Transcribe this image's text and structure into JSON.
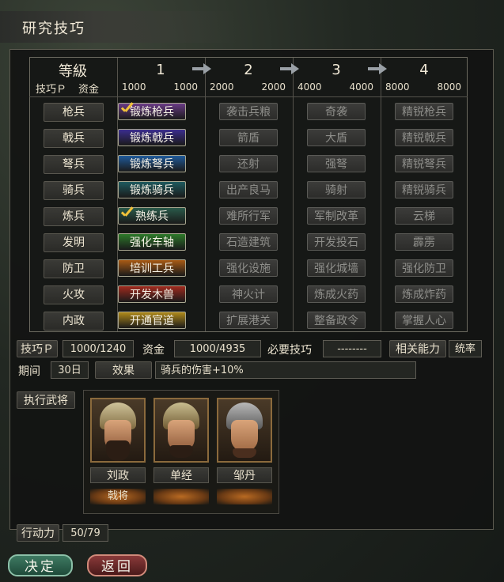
{
  "window": {
    "title": "研究技巧"
  },
  "header": {
    "level_label": "等級",
    "tech_p_label": "技巧Ｐ",
    "funds_label": "资金",
    "tiers": [
      {
        "num": "1",
        "p": "1000",
        "f": "1000"
      },
      {
        "num": "2",
        "p": "2000",
        "f": "2000"
      },
      {
        "num": "3",
        "p": "4000",
        "f": "4000"
      },
      {
        "num": "4",
        "p": "8000",
        "f": "8000"
      }
    ]
  },
  "rows": [
    {
      "label": "枪兵",
      "cells": [
        "锻炼枪兵",
        "袭击兵粮",
        "奇袭",
        "精锐枪兵"
      ],
      "colors": [
        "#6a3b86",
        "",
        "",
        ""
      ],
      "checked": true
    },
    {
      "label": "戟兵",
      "cells": [
        "锻炼戟兵",
        "箭盾",
        "大盾",
        "精锐戟兵"
      ],
      "colors": [
        "#3b2e8e",
        "",
        "",
        ""
      ],
      "checked": false
    },
    {
      "label": "弩兵",
      "cells": [
        "锻炼弩兵",
        "还射",
        "强弩",
        "精锐弩兵"
      ],
      "colors": [
        "#1f5a9a",
        "",
        "",
        ""
      ],
      "checked": false
    },
    {
      "label": "骑兵",
      "cells": [
        "锻炼骑兵",
        "出产良马",
        "骑射",
        "精锐骑兵"
      ],
      "colors": [
        "#1e5a5e",
        "",
        "",
        ""
      ],
      "checked": false
    },
    {
      "label": "炼兵",
      "cells": [
        "熟练兵",
        "难所行军",
        "军制改革",
        "云梯"
      ],
      "colors": [
        "#2a5a4a",
        "",
        "",
        ""
      ],
      "checked": true
    },
    {
      "label": "发明",
      "cells": [
        "强化车轴",
        "石造建筑",
        "开发投石",
        "霹雳"
      ],
      "colors": [
        "#2e7a2a",
        "",
        "",
        ""
      ],
      "checked": false
    },
    {
      "label": "防卫",
      "cells": [
        "培训工兵",
        "强化设施",
        "强化城墙",
        "强化防卫"
      ],
      "colors": [
        "#a85a14",
        "",
        "",
        ""
      ],
      "checked": false
    },
    {
      "label": "火攻",
      "cells": [
        "开发木兽",
        "神火计",
        "炼成火药",
        "炼成炸药"
      ],
      "colors": [
        "#a02a1e",
        "",
        "",
        ""
      ],
      "checked": false
    },
    {
      "label": "内政",
      "cells": [
        "开通官道",
        "扩展港关",
        "整备政令",
        "掌握人心"
      ],
      "colors": [
        "#b08a1a",
        "",
        "",
        ""
      ],
      "checked": false
    }
  ],
  "info": {
    "tech_p_label": "技巧Ｐ",
    "tech_p_value": "1000/1240",
    "funds_label": "资金",
    "funds_value": "1000/4935",
    "req_label": "必要技巧",
    "req_value": "--------",
    "ability_label": "相关能力",
    "ability_value": "统率",
    "period_label": "期间",
    "period_value": "30日",
    "effect_label": "效果",
    "effect_value": "骑兵的伤害+10%"
  },
  "officers": {
    "section_label": "执行武将",
    "list": [
      {
        "name": "刘政",
        "trait": "戟将"
      },
      {
        "name": "单经",
        "trait": ""
      },
      {
        "name": "邹丹",
        "trait": ""
      }
    ]
  },
  "action": {
    "label": "行动力",
    "value": "50/79"
  },
  "buttons": {
    "confirm": "决定",
    "back": "返回"
  }
}
